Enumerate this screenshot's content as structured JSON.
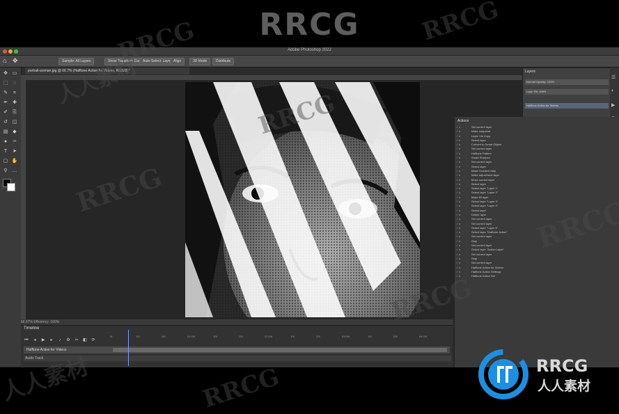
{
  "banner": {
    "title": "RRCG"
  },
  "app": {
    "title": "Adobe Photoshop 2022"
  },
  "options_bar": {
    "items": [
      "Sample: All Layers",
      "Show Transform Controls",
      "Auto-Select: Layer",
      "Align",
      "3D Mode",
      "Distribute"
    ]
  },
  "document": {
    "tab": "portrait-woman.jpg @ 66.7% (Halftone Action for Videos, RGB/8) *"
  },
  "status": {
    "text": "66.67%    Efficiency: 100%"
  },
  "timeline": {
    "title": "Timeline",
    "ticks": [
      "0f",
      "10f",
      "20f",
      "01:00f",
      "10f",
      "20f",
      "02:00f",
      "10f",
      "20f",
      "03:00f",
      "10f",
      "20f",
      "04:00f"
    ],
    "clip_label": "Halftone Action for Videos",
    "audio_label": "Audio Track"
  },
  "layers_panel": {
    "tab": "Layers",
    "rows": [
      "Normal    Opacity: 100%",
      "Lock:    Fill: 100%",
      "Halftone Action for Videos"
    ]
  },
  "actions_panel": {
    "title": "Actions",
    "items": [
      "Set current layer",
      "Make snapshot",
      "Layer Via Copy",
      "Select layer",
      "Convert to Smart Object",
      "Set current layer",
      "Halftone Pattern",
      "Smart Sharpen",
      "Set current layer",
      "Select layer",
      "Make Gradient Map",
      "Make adjustment layer",
      "Move current layer",
      "Select layer",
      "Select layer \"Layer 1\"",
      "Select layer \"Layer 2\"",
      "Make fill layer",
      "Select layer \"Layer 3\"",
      "Select layer \"Layer 4\"",
      "Select layer",
      "Delete layer",
      "Set current layer",
      "Set current layer",
      "Select layer \"Layer 5\"",
      "Select layer \"Halftone Action\"",
      "Set current layer",
      "Stop",
      "Set current layer",
      "Select layer \"Action Layer\"",
      "Set current layer",
      "Stop",
      "Set current layer",
      "Halftone Action for Videos",
      "Halftone Action Settings",
      "Halftone Action Set"
    ]
  },
  "watermarks": [
    "RRCG",
    "人人素材",
    "RRCG",
    "RRCG",
    "RRCG",
    "RRCG",
    "RRCG",
    "人人素材",
    "RRCG"
  ],
  "brand": {
    "text": "RRCG",
    "subtitle": "人人素材",
    "accent": "#1e8fe0"
  },
  "colors": {
    "app_bg": "#2b2b2b",
    "panel_bg": "#3a3a3a",
    "banner_text": "#5e5e5e"
  }
}
